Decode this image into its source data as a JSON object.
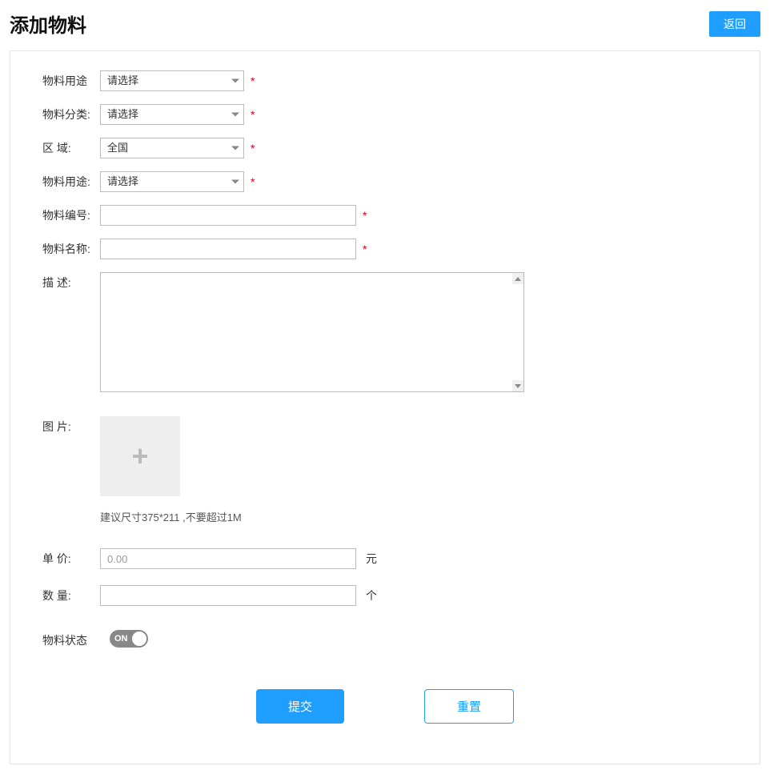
{
  "header": {
    "title": "添加物料",
    "back_label": "返回"
  },
  "form": {
    "field_purpose1": {
      "label": "物料用途",
      "value": "请选择"
    },
    "field_category": {
      "label": "物料分类:",
      "value": "请选择"
    },
    "field_region": {
      "label": "区  域:",
      "value": "全国"
    },
    "field_purpose2": {
      "label": "物料用途:",
      "value": "请选择"
    },
    "field_code": {
      "label": "物料编号:",
      "value": ""
    },
    "field_name": {
      "label": "物料名称:",
      "value": ""
    },
    "field_desc": {
      "label": "描    述:",
      "value": ""
    },
    "field_image": {
      "label": "图  片:",
      "hint": "建议尺寸375*211 ,不要超过1M"
    },
    "field_price": {
      "label": "单  价:",
      "placeholder": "0.00",
      "value": "",
      "unit": "元"
    },
    "field_qty": {
      "label": "数  量:",
      "value": "",
      "unit": "个"
    },
    "field_status": {
      "label": "物料状态",
      "toggle_text": "ON"
    },
    "required_mark": "*"
  },
  "buttons": {
    "submit": "提交",
    "reset": "重置"
  }
}
